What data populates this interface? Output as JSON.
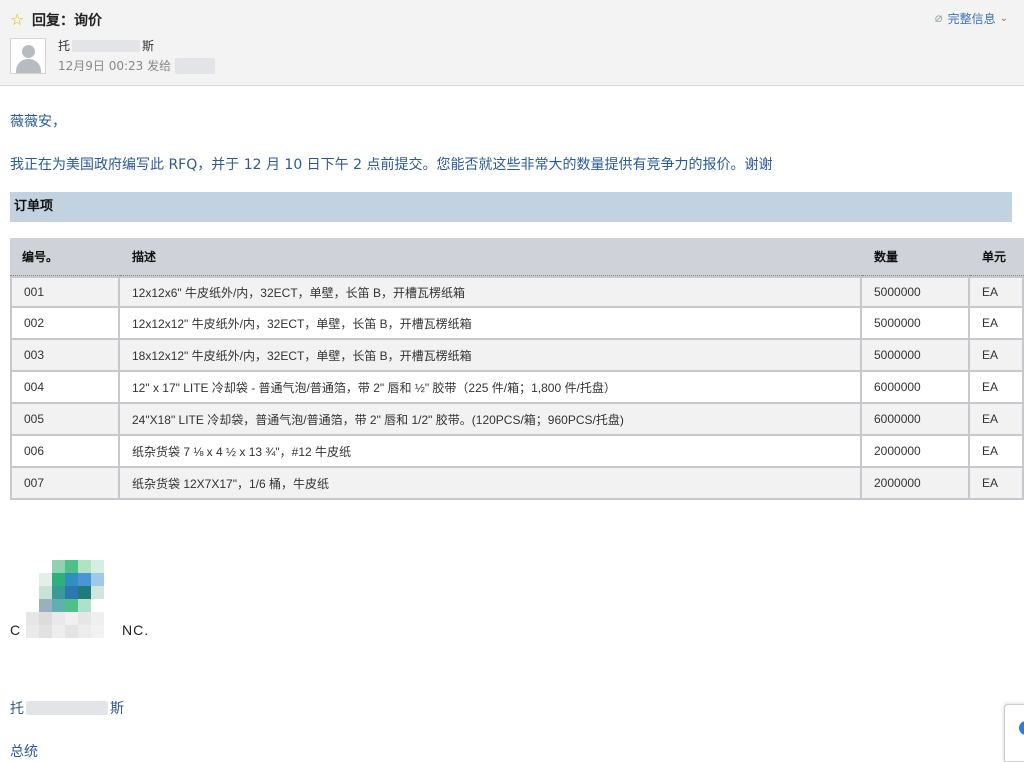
{
  "header": {
    "star_icon": "star-icon",
    "subject": "回复：询价",
    "full_info_label": "完整信息",
    "attachment_icon": "paperclip-icon",
    "sender_prefix": "托",
    "sender_suffix": "斯",
    "date": "12月9日 00:23 发给"
  },
  "body": {
    "greeting": "薇薇安，",
    "intro": "我正在为美国政府编写此 RFQ，并于 12 月 10 日下午 2 点前提交。您能否就这些非常大的数量提供有竞争力的报价。谢谢",
    "section_title": "订单项"
  },
  "table": {
    "headers": {
      "no": "编号。",
      "desc": "描述",
      "qty": "数量",
      "unit": "单元"
    },
    "rows": [
      {
        "no": "001",
        "desc": "12x12x6\" 牛皮纸外/内，32ECT，单壁，长笛 B，开槽瓦楞纸箱",
        "qty": "5000000",
        "unit": "EA"
      },
      {
        "no": "002",
        "desc": "12x12x12\" 牛皮纸外/内，32ECT，单壁，长笛 B，开槽瓦楞纸箱",
        "qty": "5000000",
        "unit": "EA"
      },
      {
        "no": "003",
        "desc": "18x12x12\" 牛皮纸外/内，32ECT，单壁，长笛 B，开槽瓦楞纸箱",
        "qty": "5000000",
        "unit": "EA"
      },
      {
        "no": "004",
        "desc": "12\" x 17\" LITE 冷却袋 - 普通气泡/普通箔，带 2\" 唇和 ½\" 胶带（225 件/箱；1,800 件/托盘）",
        "qty": "6000000",
        "unit": "EA"
      },
      {
        "no": "005",
        "desc": "24\"X18\" LITE 冷却袋，普通气泡/普通箔，带 2\" 唇和 1/2\" 胶带。(120PCS/箱；960PCS/托盘)",
        "qty": "6000000",
        "unit": "EA"
      },
      {
        "no": "006",
        "desc": "纸杂货袋 7 ⅛ x 4 ½ x 13 ¾\"，#12 牛皮纸",
        "qty": "2000000",
        "unit": "EA"
      },
      {
        "no": "007",
        "desc": "纸杂货袋 12X7X17\"，1/6 桶，牛皮纸",
        "qty": "2000000",
        "unit": "EA"
      }
    ]
  },
  "signature": {
    "logo_text_left": "C",
    "logo_text_right": "NC.",
    "name_prefix": "托",
    "name_suffix": "斯",
    "title": "总统"
  },
  "colors": {
    "link_blue": "#2a5a9a",
    "section_bar": "#c3d2e0",
    "star": "#e8b400"
  }
}
